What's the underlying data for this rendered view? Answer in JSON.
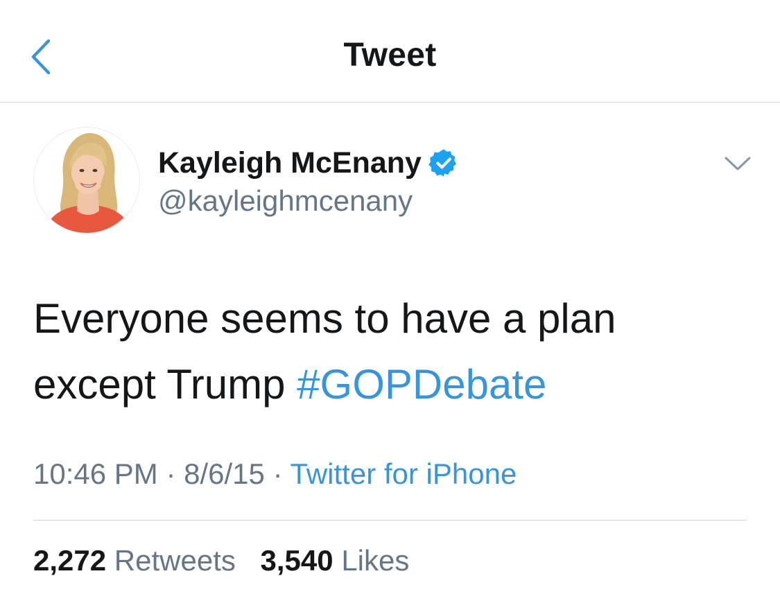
{
  "colors": {
    "accent": "#3b94d9",
    "text": "#14171a",
    "secondary": "#657786",
    "divider": "#d6d9db",
    "verified_badge": "#1da1f2"
  },
  "nav": {
    "back_icon": "chevron-left-icon",
    "title": "Tweet"
  },
  "tweet": {
    "author": {
      "avatar": "profile-photo",
      "display_name": "Kayleigh McEnany",
      "verified_icon": "verified-badge-icon",
      "handle": "@kayleighmcenany"
    },
    "menu_icon": "chevron-down-icon",
    "text_line1": "Everyone seems to have a plan",
    "text_line2": "except Trump",
    "hashtag": "#GOPDebate",
    "time": "10:46 PM",
    "separator": "·",
    "date": "8/6/15",
    "source": "Twitter for iPhone",
    "stats": {
      "retweets_count": "2,272",
      "retweets_label": "Retweets",
      "likes_count": "3,540",
      "likes_label": "Likes"
    }
  }
}
